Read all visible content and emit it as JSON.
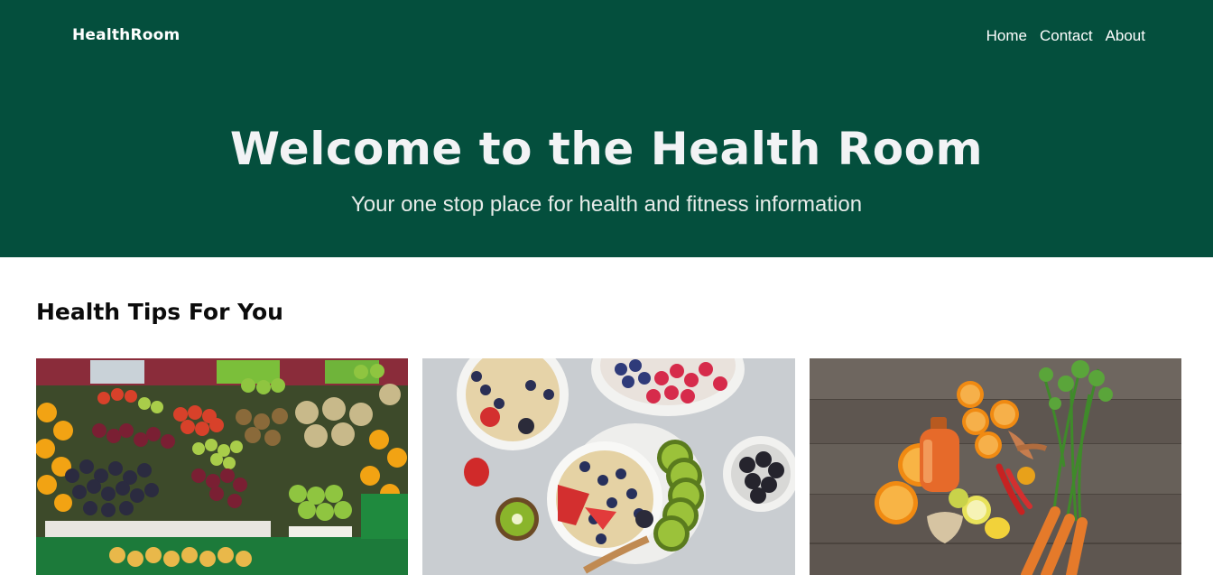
{
  "header": {
    "brand": "HealthRoom",
    "nav": [
      {
        "label": "Home"
      },
      {
        "label": "Contact"
      },
      {
        "label": "About"
      }
    ]
  },
  "hero": {
    "title": "Welcome to the Health Room",
    "subtitle": "Your one stop place for health and fitness information"
  },
  "tips": {
    "title": "Health Tips For You"
  },
  "colors": {
    "header_bg": "#044f3d",
    "header_text": "#ffffff",
    "page_bg": "#ffffff"
  }
}
